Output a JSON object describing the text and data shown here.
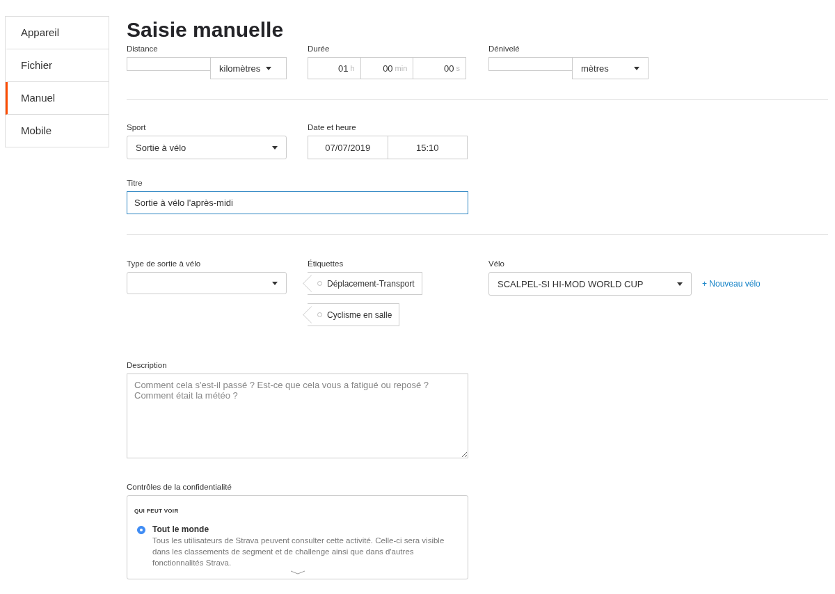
{
  "sidebar": {
    "items": [
      {
        "label": "Appareil",
        "selected": false
      },
      {
        "label": "Fichier",
        "selected": false
      },
      {
        "label": "Manuel",
        "selected": true
      },
      {
        "label": "Mobile",
        "selected": false
      }
    ]
  },
  "page_title": "Saisie manuelle",
  "distance": {
    "label": "Distance",
    "unit": "kilomètres"
  },
  "duration": {
    "label": "Durée",
    "parts": [
      {
        "value": "01",
        "unit": "h"
      },
      {
        "value": "00",
        "unit": "min"
      },
      {
        "value": "00",
        "unit": "s"
      }
    ]
  },
  "elevation": {
    "label": "Dénivelé",
    "unit": "mètres"
  },
  "sport": {
    "label": "Sport",
    "value": "Sortie à vélo"
  },
  "datetime": {
    "label": "Date et heure",
    "date": "07/07/2019",
    "time": "15:10"
  },
  "title_field": {
    "label": "Titre",
    "value": "Sortie à vélo l'après-midi",
    "focused": true
  },
  "ride_type": {
    "label": "Type de sortie à vélo"
  },
  "tags": {
    "label": "Étiquettes",
    "items": [
      {
        "label": "Déplacement-Transport",
        "checked": false
      },
      {
        "label": "Cyclisme en salle",
        "checked": false
      }
    ]
  },
  "bike": {
    "label": "Vélo",
    "value": "SCALPEL-SI HI-MOD WORLD CUP",
    "new_link": "+ Nouveau vélo"
  },
  "description": {
    "label": "Description",
    "placeholder": "Comment cela s'est-il passé ? Est-ce que cela vous a fatigué ou reposé ? Comment était la météo ?"
  },
  "privacy": {
    "label": "Contrôles de la confidentialité",
    "heading": "QUI PEUT VOIR",
    "options": [
      {
        "title": "Tout le monde",
        "description": "Tous les utilisateurs de Strava peuvent consulter cette activité. Celle-ci sera visible dans les classements de segment et de challenge ainsi que dans d'autres fonctionnalités Strava.",
        "selected": true
      }
    ]
  }
}
